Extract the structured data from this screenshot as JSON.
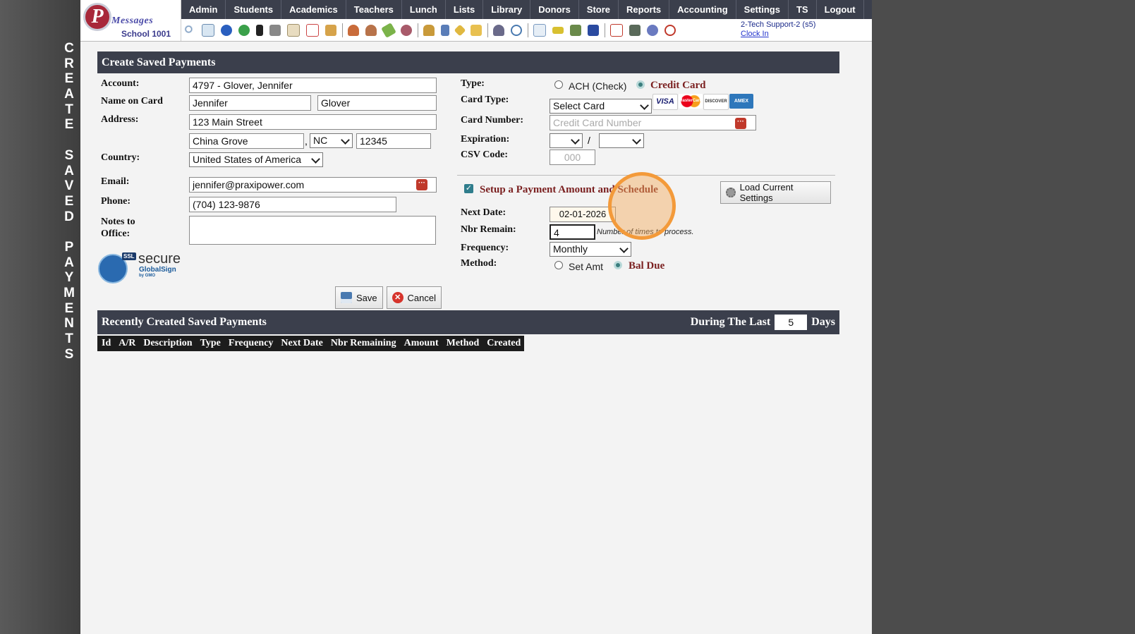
{
  "vertical_title": "CREATE SAVED PAYMENTS",
  "logo": {
    "brand": "Messages",
    "school": "School 1001"
  },
  "menu": [
    "Admin",
    "Students",
    "Academics",
    "Teachers",
    "Lunch",
    "Lists",
    "Library",
    "Donors",
    "Store",
    "Reports",
    "Accounting",
    "Settings",
    "TS",
    "Logout"
  ],
  "support": {
    "user": "2-Tech Support-2 (s5)",
    "clock_in": "Clock In"
  },
  "form": {
    "title": "Create Saved Payments",
    "account_label": "Account:",
    "account_value": "4797 - Glover, Jennifer",
    "name_label": "Name on Card",
    "first_name": "Jennifer",
    "last_name": "Glover",
    "address_label": "Address:",
    "street": "123 Main Street",
    "city": "China Grove",
    "comma": ",",
    "state": "NC",
    "zip": "12345",
    "country_label": "Country:",
    "country": "United States of America",
    "email_label": "Email:",
    "email": "jennifer@praxipower.com",
    "phone_label": "Phone:",
    "phone": "(704) 123-9876",
    "notes_label_1": "Notes to",
    "notes_label_2": "Office:",
    "notes": "",
    "ssl_badge": {
      "ssl": "SSL",
      "secure": "secure",
      "provider": "GlobalSign",
      "by": "by GMO"
    },
    "type_label": "Type:",
    "type_ach": "ACH (Check)",
    "type_credit": "Credit Card",
    "card_type_label": "Card Type:",
    "card_type_value": "Select Card",
    "card_logos": [
      "VISA",
      "MasterCard",
      "DISCOVER",
      "AMEX"
    ],
    "card_number_label": "Card Number:",
    "card_number_placeholder": "Credit Card Number",
    "expiration_label": "Expiration:",
    "expiration_slash": "/",
    "expiration_month": "",
    "expiration_year": "",
    "csv_label": "CSV Code:",
    "csv_placeholder": "000",
    "setup_checkbox_label": "Setup a Payment Amount and Schedule",
    "setup_checked": true,
    "load_button": "Load Current Settings",
    "next_date_label": "Next Date:",
    "next_date": "02-01-2026",
    "nbr_remaining_label": "Nbr Remain:",
    "nbr_remaining": "4",
    "nbr_hint": "Number of times to process.",
    "frequency_label": "Frequency:",
    "frequency": "Monthly",
    "method_label": "Method:",
    "method_set_amt": "Set Amt",
    "method_bal_due": "Bal Due",
    "save_button": "Save",
    "cancel_button": "Cancel"
  },
  "recent": {
    "title": "Recently Created Saved Payments",
    "during_label": "During The Last",
    "days_value": "5",
    "days_label": "Days",
    "columns": [
      "Id",
      "A/R",
      "Description",
      "Type",
      "Frequency",
      "Next Date",
      "Nbr Remaining",
      "Amount",
      "Method",
      "Created"
    ]
  },
  "colors": {
    "header_bg": "#3b3f4c",
    "accent_red": "#7a1f1f",
    "highlight": "#f39a3a"
  }
}
